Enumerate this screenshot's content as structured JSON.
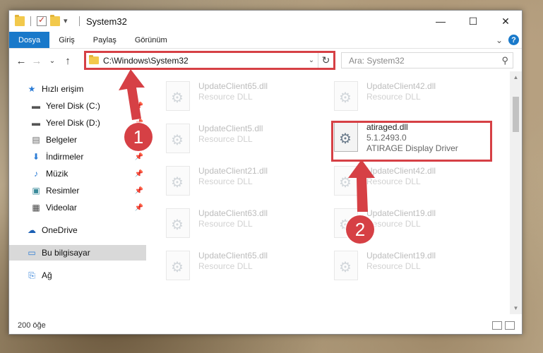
{
  "window": {
    "title": "System32",
    "controls": {
      "minimize": "—",
      "maximize": "☐",
      "close": "✕"
    }
  },
  "ribbon": {
    "tabs": [
      "Dosya",
      "Giriş",
      "Paylaş",
      "Görünüm"
    ],
    "expand": "⌄",
    "help": "?"
  },
  "toolbar": {
    "back": "←",
    "forward": "→",
    "recent": "⌄",
    "up": "↑",
    "address": "C:\\Windows\\System32",
    "address_caret": "⌄",
    "refresh": "↻",
    "search_placeholder": "Ara: System32",
    "search_icon": "search-icon"
  },
  "nav": {
    "items": [
      {
        "label": "Hızlı erişim",
        "icon": "star-icon",
        "pinned": false
      },
      {
        "label": "Yerel Disk (C:)",
        "icon": "drive-icon",
        "pinned": true
      },
      {
        "label": "Yerel Disk (D:)",
        "icon": "drive-icon",
        "pinned": true
      },
      {
        "label": "Belgeler",
        "icon": "document-icon",
        "pinned": true
      },
      {
        "label": "İndirmeler",
        "icon": "download-icon",
        "pinned": true
      },
      {
        "label": "Müzik",
        "icon": "music-icon",
        "pinned": true
      },
      {
        "label": "Resimler",
        "icon": "pictures-icon",
        "pinned": true
      },
      {
        "label": "Videolar",
        "icon": "video-icon",
        "pinned": true
      },
      {
        "label": "OneDrive",
        "icon": "cloud-icon",
        "pinned": false
      },
      {
        "label": "Bu bilgisayar",
        "icon": "computer-icon",
        "pinned": false
      },
      {
        "label": "Ağ",
        "icon": "network-icon",
        "pinned": false
      }
    ]
  },
  "files": [
    {
      "name": "UpdateClient65.dll",
      "sub": "Resource DLL"
    },
    {
      "name": "UpdateClient42.dll",
      "sub": "Resource DLL"
    },
    {
      "name": "UpdateClient5.dll",
      "sub": "Resource DLL"
    },
    {
      "name": "atiraged.dll",
      "sub": "5.1.2493.0",
      "sub2": "ATIRAGE Display Driver"
    },
    {
      "name": "UpdateClient21.dll",
      "sub": "Resource DLL"
    },
    {
      "name": "UpdateClient42.dll",
      "sub": "Resource DLL"
    },
    {
      "name": "UpdateClient63.dll",
      "sub": "Resource DLL"
    },
    {
      "name": "UpdateClient19.dll",
      "sub": "Resource DLL"
    },
    {
      "name": "UpdateClient65.dll",
      "sub": "Resource DLL"
    },
    {
      "name": "UpdateClient19.dll",
      "sub": "Resource DLL"
    }
  ],
  "status": {
    "count": "200 öğe"
  },
  "annotations": {
    "badge1": "1",
    "badge2": "2"
  },
  "colors": {
    "accent": "#1979ca",
    "highlight": "#d64045"
  }
}
